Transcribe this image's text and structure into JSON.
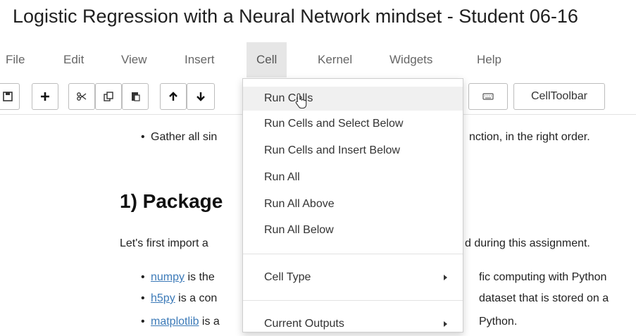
{
  "window": {
    "title": "Logistic Regression with a Neural Network mindset - Student 06-16"
  },
  "menubar": {
    "items": [
      "File",
      "Edit",
      "View",
      "Insert",
      "Cell",
      "Kernel",
      "Widgets",
      "Help"
    ],
    "active": "Cell"
  },
  "toolbar": {
    "buttons": [
      "save-icon",
      "plus-icon",
      "cut-icon",
      "copy-icon",
      "paste-icon",
      "arrow-up-icon",
      "arrow-down-icon",
      "keyboard-icon"
    ],
    "celltoolbar_label": "CellToolbar"
  },
  "cell_menu": {
    "items": [
      "Run Cells",
      "Run Cells and Select Below",
      "Run Cells and Insert Below",
      "Run All",
      "Run All Above",
      "Run All Below",
      "Cell Type",
      "Current Outputs"
    ],
    "hovered": "Run Cells"
  },
  "notebook": {
    "bullet_gather_left": "Gather all sin",
    "bullet_gather_right": "nction, in the right order.",
    "heading": "1) Package",
    "para_left": "Let's first import a",
    "para_right": "d during this assignment.",
    "bullets": [
      {
        "link": "numpy",
        "left": " is the",
        "right": "fic computing with Python"
      },
      {
        "link": "h5py",
        "left": " is a con",
        "right": "dataset that is stored on a"
      },
      {
        "link": "matplotlib",
        "left": " is a",
        "right": "Python."
      }
    ]
  },
  "colors": {
    "menu_active_bg": "#e6e6e6",
    "link": "#3c7ab8",
    "hover_bg": "#f0f0f0"
  }
}
